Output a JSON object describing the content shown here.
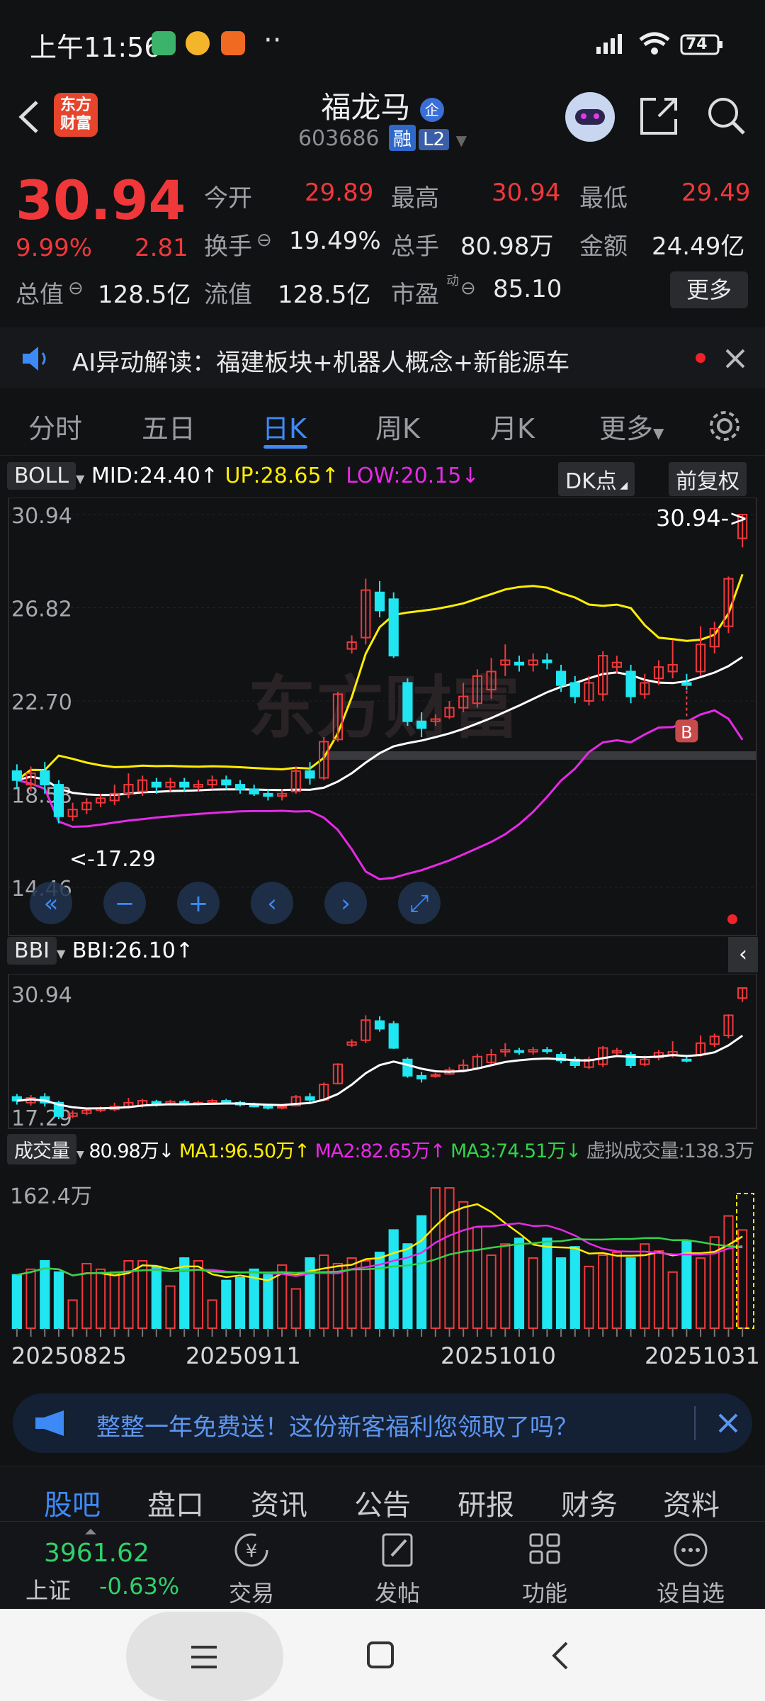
{
  "status_bar": {
    "time": "上午11:56",
    "battery": "74",
    "dots": "··"
  },
  "header": {
    "logo_text": "东方财富",
    "title": "福龙马",
    "title_badge": "企",
    "code": "603686",
    "tag_margin": "融",
    "tag_level": "L2"
  },
  "quote": {
    "price": "30.94",
    "change_pct": "9.99%",
    "change": "2.81",
    "open_label": "今开",
    "open": "29.89",
    "high_label": "最高",
    "high": "30.94",
    "low_label": "最低",
    "low": "29.49",
    "turnover_label": "换手",
    "turnover": "19.49%",
    "volume_label": "总手",
    "volume": "80.98万",
    "amount_label": "金额",
    "amount": "24.49亿",
    "mktcap_label": "总值",
    "mktcap": "128.5亿",
    "float_label": "流值",
    "float": "128.5亿",
    "pe_label": "市盈",
    "pe_sup": "动",
    "pe": "85.10",
    "more_label": "更多"
  },
  "ai_bar": {
    "text": "AI异动解读：福建板块+机器人概念+新能源车"
  },
  "tabs": {
    "items": [
      "分时",
      "五日",
      "日K",
      "周K",
      "月K",
      "更多"
    ],
    "active": 2
  },
  "boll_bar": {
    "name": "BOLL",
    "mid": "MID:24.40",
    "up": "UP:28.65",
    "low": "LOW:20.15",
    "dk": "DK点",
    "fq": "前复权"
  },
  "kline": {
    "y_labels": [
      "30.94",
      "26.82",
      "22.70",
      "18.58",
      "14.46"
    ],
    "last_label": "30.94->",
    "min_label": "<-17.29",
    "watermark": "东方财富",
    "b_marker": "B"
  },
  "bbi_bar": {
    "name": "BBI",
    "value": "BBI:26.10"
  },
  "bbi_chart": {
    "y_top": "30.94",
    "y_bottom": "17.29"
  },
  "vol_bar": {
    "name": "成交量",
    "vol": "80.98万",
    "ma1": "MA1:96.50万",
    "ma2": "MA2:82.65万",
    "ma3": "MA3:74.51万",
    "virtual": "虚拟成交量:138.3万"
  },
  "vol_chart": {
    "y_top": "162.4万"
  },
  "dates": [
    "20250825",
    "20250911",
    "20251010",
    "20251031"
  ],
  "colors": {
    "up": "#f0383b",
    "down": "#1fe6f0",
    "boll_up": "#ffee00",
    "boll_low": "#e62ae6",
    "mid": "#ffffff",
    "ma3": "#32d24a"
  },
  "promo": {
    "text": "整整一年免费送！这份新客福利您领取了吗？"
  },
  "bottom_tabs": {
    "items": [
      "股吧",
      "盘口",
      "资讯",
      "公告",
      "研报",
      "财务",
      "资料"
    ],
    "active": 0
  },
  "bottom_nav": {
    "index_value": "3961.62",
    "index_name": "上证",
    "index_change": "-0.63%",
    "trade": "交易",
    "post": "发帖",
    "func": "功能",
    "watch": "设自选"
  },
  "chart_data": {
    "type": "candlestick",
    "price_axis": {
      "max": 30.94,
      "min": 14.46,
      "ticks": [
        30.94,
        26.82,
        22.7,
        18.58,
        14.46
      ]
    },
    "candles": [
      {
        "o": 19.6,
        "c": 19.2,
        "h": 19.9,
        "l": 18.8
      },
      {
        "o": 19.0,
        "c": 19.5,
        "h": 19.8,
        "l": 18.7
      },
      {
        "o": 19.6,
        "c": 19.0,
        "h": 20.0,
        "l": 18.6
      },
      {
        "o": 19.0,
        "c": 17.6,
        "h": 19.2,
        "l": 17.29
      },
      {
        "o": 17.6,
        "c": 17.9,
        "h": 18.2,
        "l": 17.4
      },
      {
        "o": 17.9,
        "c": 18.2,
        "h": 18.4,
        "l": 17.7
      },
      {
        "o": 18.2,
        "c": 18.4,
        "h": 18.6,
        "l": 18.0
      },
      {
        "o": 18.3,
        "c": 18.6,
        "h": 19.0,
        "l": 18.1
      },
      {
        "o": 18.6,
        "c": 19.0,
        "h": 19.5,
        "l": 18.4
      },
      {
        "o": 18.7,
        "c": 19.2,
        "h": 19.4,
        "l": 18.5
      },
      {
        "o": 19.1,
        "c": 18.9,
        "h": 19.3,
        "l": 18.6
      },
      {
        "o": 18.9,
        "c": 19.1,
        "h": 19.3,
        "l": 18.7
      },
      {
        "o": 19.1,
        "c": 18.9,
        "h": 19.3,
        "l": 18.7
      },
      {
        "o": 18.9,
        "c": 19.0,
        "h": 19.2,
        "l": 18.7
      },
      {
        "o": 19.0,
        "c": 19.2,
        "h": 19.4,
        "l": 18.8
      },
      {
        "o": 19.2,
        "c": 19.0,
        "h": 19.4,
        "l": 18.8
      },
      {
        "o": 19.0,
        "c": 18.8,
        "h": 19.2,
        "l": 18.6
      },
      {
        "o": 18.8,
        "c": 18.6,
        "h": 19.0,
        "l": 18.5
      },
      {
        "o": 18.6,
        "c": 18.5,
        "h": 18.8,
        "l": 18.3
      },
      {
        "o": 18.5,
        "c": 18.6,
        "h": 18.8,
        "l": 18.3
      },
      {
        "o": 18.7,
        "c": 19.6,
        "h": 19.8,
        "l": 18.6
      },
      {
        "o": 19.6,
        "c": 19.3,
        "h": 20.0,
        "l": 19.0
      },
      {
        "o": 19.3,
        "c": 20.9,
        "h": 21.1,
        "l": 19.2
      },
      {
        "o": 21.0,
        "c": 23.0,
        "h": 23.1,
        "l": 20.9
      },
      {
        "o": 25.0,
        "c": 25.3,
        "h": 25.6,
        "l": 24.8
      },
      {
        "o": 25.5,
        "c": 27.6,
        "h": 28.1,
        "l": 25.2
      },
      {
        "o": 27.5,
        "c": 26.7,
        "h": 28.0,
        "l": 26.4
      },
      {
        "o": 27.2,
        "c": 24.7,
        "h": 27.5,
        "l": 24.6
      },
      {
        "o": 23.5,
        "c": 21.8,
        "h": 23.7,
        "l": 21.6
      },
      {
        "o": 21.8,
        "c": 21.5,
        "h": 22.2,
        "l": 21.1
      },
      {
        "o": 21.8,
        "c": 21.9,
        "h": 22.1,
        "l": 21.6
      },
      {
        "o": 22.0,
        "c": 22.4,
        "h": 22.7,
        "l": 21.9
      },
      {
        "o": 22.4,
        "c": 22.9,
        "h": 23.5,
        "l": 22.2
      },
      {
        "o": 22.6,
        "c": 23.8,
        "h": 24.1,
        "l": 22.4
      },
      {
        "o": 23.2,
        "c": 24.0,
        "h": 24.6,
        "l": 22.8
      },
      {
        "o": 24.3,
        "c": 24.5,
        "h": 25.2,
        "l": 23.8
      },
      {
        "o": 24.4,
        "c": 24.3,
        "h": 24.7,
        "l": 24.0
      },
      {
        "o": 24.3,
        "c": 24.5,
        "h": 24.8,
        "l": 24.0
      },
      {
        "o": 24.5,
        "c": 24.4,
        "h": 24.8,
        "l": 24.1
      },
      {
        "o": 24.0,
        "c": 23.4,
        "h": 24.3,
        "l": 23.1
      },
      {
        "o": 23.5,
        "c": 22.9,
        "h": 23.8,
        "l": 22.6
      },
      {
        "o": 22.7,
        "c": 23.5,
        "h": 23.8,
        "l": 22.5
      },
      {
        "o": 23.0,
        "c": 24.7,
        "h": 24.9,
        "l": 22.7
      },
      {
        "o": 24.2,
        "c": 24.4,
        "h": 24.7,
        "l": 23.9
      },
      {
        "o": 24.0,
        "c": 22.9,
        "h": 24.3,
        "l": 22.6
      },
      {
        "o": 23.0,
        "c": 23.5,
        "h": 23.9,
        "l": 22.8
      },
      {
        "o": 23.7,
        "c": 24.2,
        "h": 24.5,
        "l": 23.4
      },
      {
        "o": 24.0,
        "c": 24.3,
        "h": 25.4,
        "l": 23.7
      },
      {
        "o": 23.5,
        "c": 23.4,
        "h": 23.9,
        "l": 23.2
      },
      {
        "o": 24.0,
        "c": 25.2,
        "h": 26.0,
        "l": 23.8
      },
      {
        "o": 25.1,
        "c": 25.9,
        "h": 26.2,
        "l": 24.8
      },
      {
        "o": 26.0,
        "c": 28.1,
        "h": 28.2,
        "l": 25.7
      },
      {
        "o": 29.89,
        "c": 30.94,
        "h": 30.94,
        "l": 29.49
      }
    ],
    "boll_up": [
      28.65
    ],
    "boll_mid": [
      24.4
    ],
    "boll_low": [
      20.15
    ],
    "bbi": [
      26.1
    ],
    "volume_axis": {
      "max": "162.4万"
    },
    "volumes": [
      38,
      42,
      48,
      40,
      20,
      46,
      42,
      40,
      48,
      48,
      44,
      30,
      50,
      48,
      20,
      34,
      36,
      42,
      38,
      45,
      28,
      50,
      52,
      46,
      50,
      48,
      54,
      70,
      60,
      80,
      100,
      100,
      90,
      72,
      52,
      60,
      64,
      50,
      64,
      50,
      58,
      44,
      52,
      54,
      50,
      60,
      55,
      40,
      62,
      50,
      65,
      80,
      70
    ]
  }
}
